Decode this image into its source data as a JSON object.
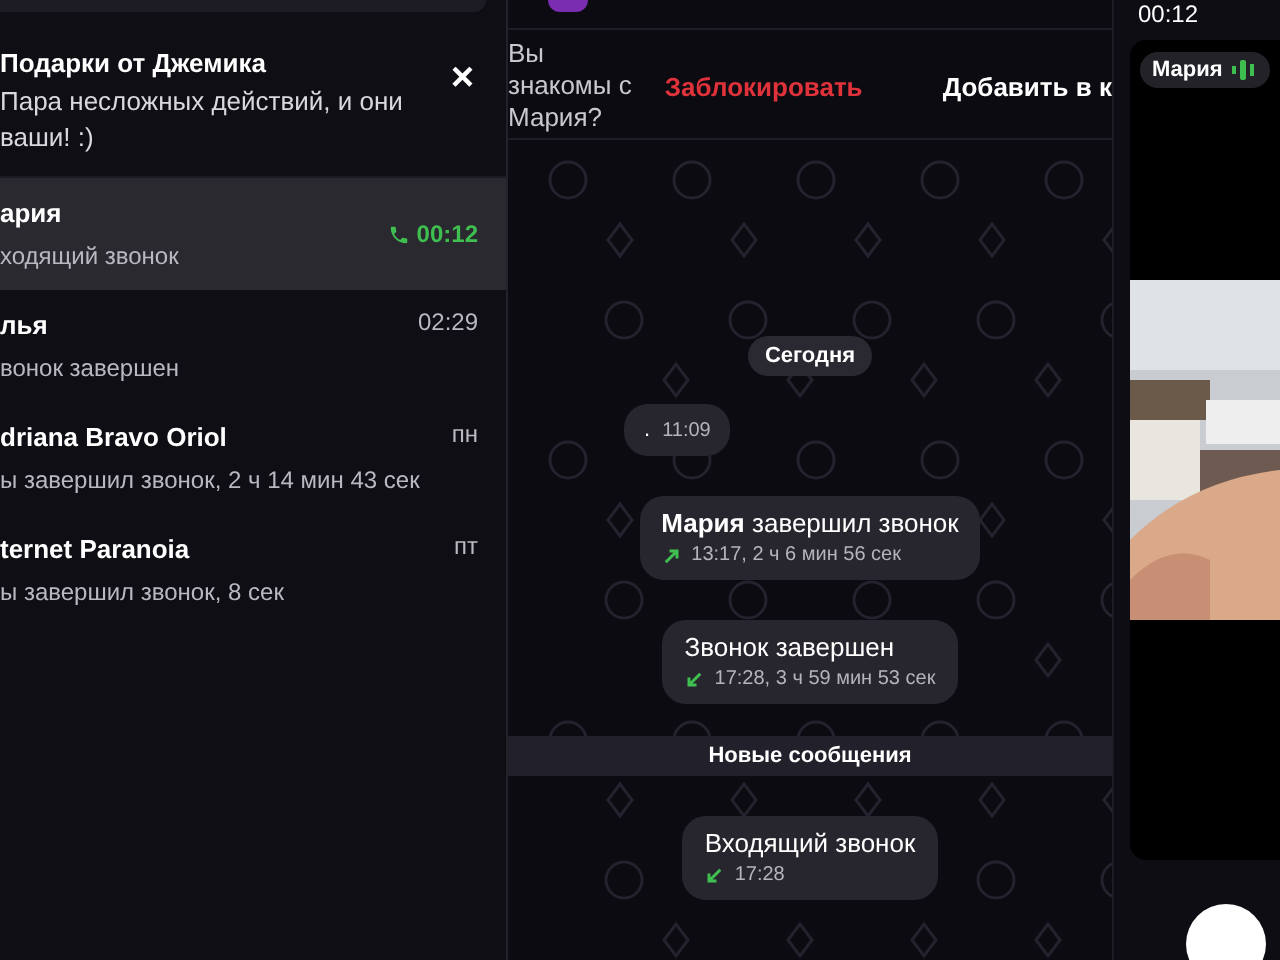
{
  "banner": {
    "title": "Подарки от Джемика",
    "text": "Пара несложных действий, и они ваши! :)",
    "close": "×"
  },
  "chats": [
    {
      "name": "ария",
      "preview": "ходящий звонок",
      "time": "00:12",
      "call_active": true,
      "selected": true
    },
    {
      "name": "лья",
      "preview": "вонок завершен",
      "time": "02:29",
      "call_active": false,
      "selected": false
    },
    {
      "name": "driana Bravo Oriol",
      "preview": "ы завершил звонок, 2 ч 14 мин 43 сек",
      "time": "пн",
      "call_active": false,
      "selected": false
    },
    {
      "name": "ternet Paranoia",
      "preview": "ы завершил звонок, 8 сек",
      "time": "пт",
      "call_active": false,
      "selected": false
    }
  ],
  "action_bar": {
    "question": "Вы знакомы с Мария?",
    "block": "Заблокировать",
    "add": "Добавить в к"
  },
  "messages": [
    {
      "kind": "date",
      "text": "Сегодня"
    },
    {
      "kind": "bubble",
      "text": ".",
      "meta": "11:09"
    },
    {
      "kind": "call",
      "text": "**Мария** завершил звонок",
      "outgoing": true,
      "meta": "13:17, 2 ч 6 мин 56 сек"
    },
    {
      "kind": "call",
      "text": "Звонок завершен",
      "outgoing": false,
      "meta": "17:28, 3 ч 59 мин 53 сек"
    },
    {
      "kind": "divider",
      "text": "Новые сообщения"
    },
    {
      "kind": "call",
      "text": "Входящий звонок",
      "outgoing": false,
      "meta": "17:28"
    }
  ],
  "call": {
    "timer": "00:12",
    "participant": "Мария",
    "speaking": true
  }
}
